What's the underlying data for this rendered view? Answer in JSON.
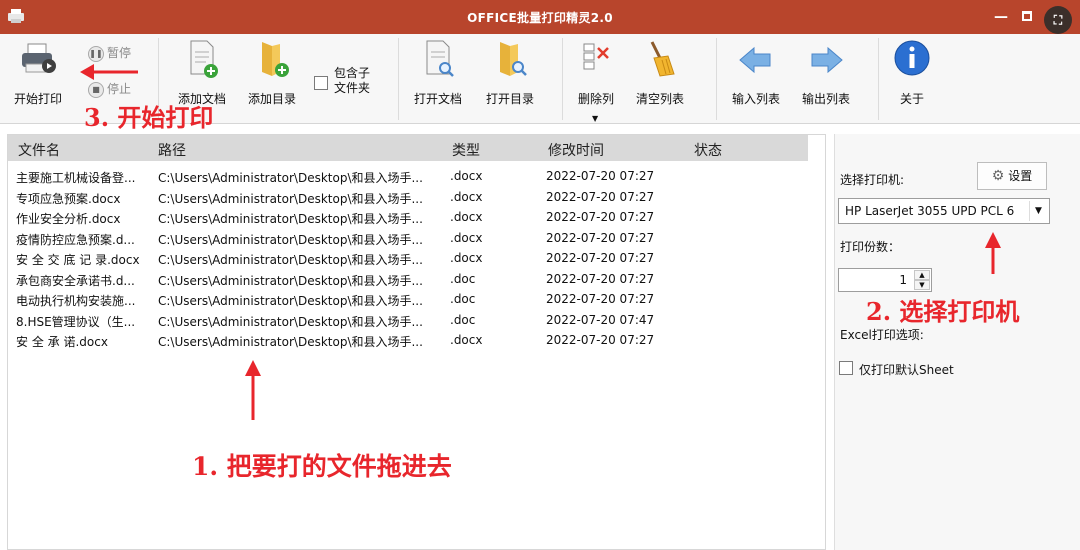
{
  "window": {
    "title": "OFFICE批量打印精灵2.0",
    "minimize": "—",
    "screenshot_icon": "⛶"
  },
  "toolbar": {
    "start_print": "开始打印",
    "pause": "暂停",
    "stop": "停止",
    "add_document": "添加文档",
    "add_folder": "添加目录",
    "include_subfolders_line1": "包含子",
    "include_subfolders_line2": "文件夹",
    "open_document": "打开文档",
    "open_folder": "打开目录",
    "delete_column": "删除列",
    "clear_list": "清空列表",
    "import_list": "输入列表",
    "export_list": "输出列表",
    "about": "关于"
  },
  "file_list": {
    "columns": [
      "文件名",
      "路径",
      "类型",
      "修改时间",
      "状态"
    ],
    "rows": [
      {
        "name": "主要施工机械设备登...",
        "path": "C:\\Users\\Administrator\\Desktop\\和县入场手...",
        "type": ".docx",
        "modified": "2022-07-20 07:27",
        "status": ""
      },
      {
        "name": "专项应急预案.docx",
        "path": "C:\\Users\\Administrator\\Desktop\\和县入场手...",
        "type": ".docx",
        "modified": "2022-07-20 07:27",
        "status": ""
      },
      {
        "name": "作业安全分析.docx",
        "path": "C:\\Users\\Administrator\\Desktop\\和县入场手...",
        "type": ".docx",
        "modified": "2022-07-20 07:27",
        "status": ""
      },
      {
        "name": "疫情防控应急预案.d...",
        "path": "C:\\Users\\Administrator\\Desktop\\和县入场手...",
        "type": ".docx",
        "modified": "2022-07-20 07:27",
        "status": ""
      },
      {
        "name": "安 全 交 底 记 录.docx",
        "path": "C:\\Users\\Administrator\\Desktop\\和县入场手...",
        "type": ".docx",
        "modified": "2022-07-20 07:27",
        "status": ""
      },
      {
        "name": "承包商安全承诺书.d...",
        "path": "C:\\Users\\Administrator\\Desktop\\和县入场手...",
        "type": ".doc",
        "modified": "2022-07-20 07:27",
        "status": ""
      },
      {
        "name": "电动执行机构安装施...",
        "path": "C:\\Users\\Administrator\\Desktop\\和县入场手...",
        "type": ".doc",
        "modified": "2022-07-20 07:27",
        "status": ""
      },
      {
        "name": "8.HSE管理协议（生...",
        "path": "C:\\Users\\Administrator\\Desktop\\和县入场手...",
        "type": ".doc",
        "modified": "2022-07-20 07:47",
        "status": ""
      },
      {
        "name": "安 全 承 诺.docx",
        "path": "C:\\Users\\Administrator\\Desktop\\和县入场手...",
        "type": ".docx",
        "modified": "2022-07-20 07:27",
        "status": ""
      }
    ]
  },
  "side_panel": {
    "select_printer_label": "选择打印机:",
    "settings_button": "设置",
    "printer_value": "HP LaserJet 3055 UPD PCL 6",
    "copies_label": "打印份数：",
    "copies_value": "1",
    "excel_options_label": "Excel打印选项:",
    "print_default_sheet_label": "仅打印默认Sheet"
  },
  "annotations": {
    "step1": "1. 把要打的文件拖进去",
    "step2": "2. 选择打印机",
    "step3": "3. 开始打印"
  },
  "colors": {
    "titlebar": "#b8452c",
    "annotation": "#e8262c",
    "header": "#d9d9d9"
  }
}
